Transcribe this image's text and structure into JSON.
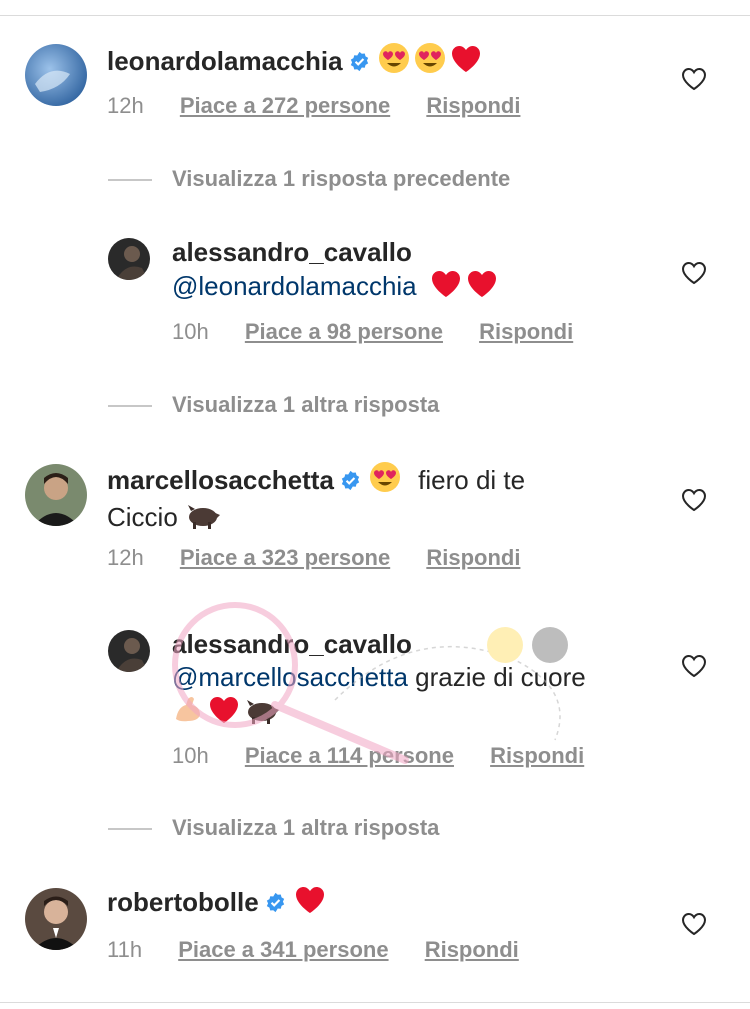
{
  "comments": [
    {
      "user": "leonardolamacchia",
      "text": "",
      "time": "12h",
      "likes": "Piace a 272 persone",
      "reply": "Rispondi",
      "view_more": "Visualizza 1 risposta precedente"
    },
    {
      "user": "alessandro_cavallo",
      "mention": "@leonardolamacchia",
      "time": "10h",
      "likes": "Piace a 98 persone",
      "reply": "Rispondi",
      "view_more": "Visualizza 1 altra risposta"
    },
    {
      "user": "marcellosacchetta",
      "text": "fiero di te",
      "text2": "Ciccio",
      "time": "12h",
      "likes": "Piace a 323 persone",
      "reply": "Rispondi"
    },
    {
      "user": "alessandro_cavallo",
      "mention": "@marcellosacchetta",
      "text": " grazie di cuore",
      "time": "10h",
      "likes": "Piace a 114 persone",
      "reply": "Rispondi",
      "view_more": "Visualizza 1 altra risposta"
    },
    {
      "user": "robertobolle",
      "time": "11h",
      "likes": "Piace a 341 persone",
      "reply": "Rispondi"
    }
  ],
  "colors": {
    "verified": "#3897f0",
    "heart": "#ed1c24",
    "mention": "#00376b",
    "secondary": "#8e8e8e"
  },
  "icons": [
    "verified-badge-icon",
    "heart-outline-icon",
    "heart-eyes-emoji",
    "red-heart-emoji",
    "flexed-biceps-emoji",
    "boar-emoji"
  ]
}
